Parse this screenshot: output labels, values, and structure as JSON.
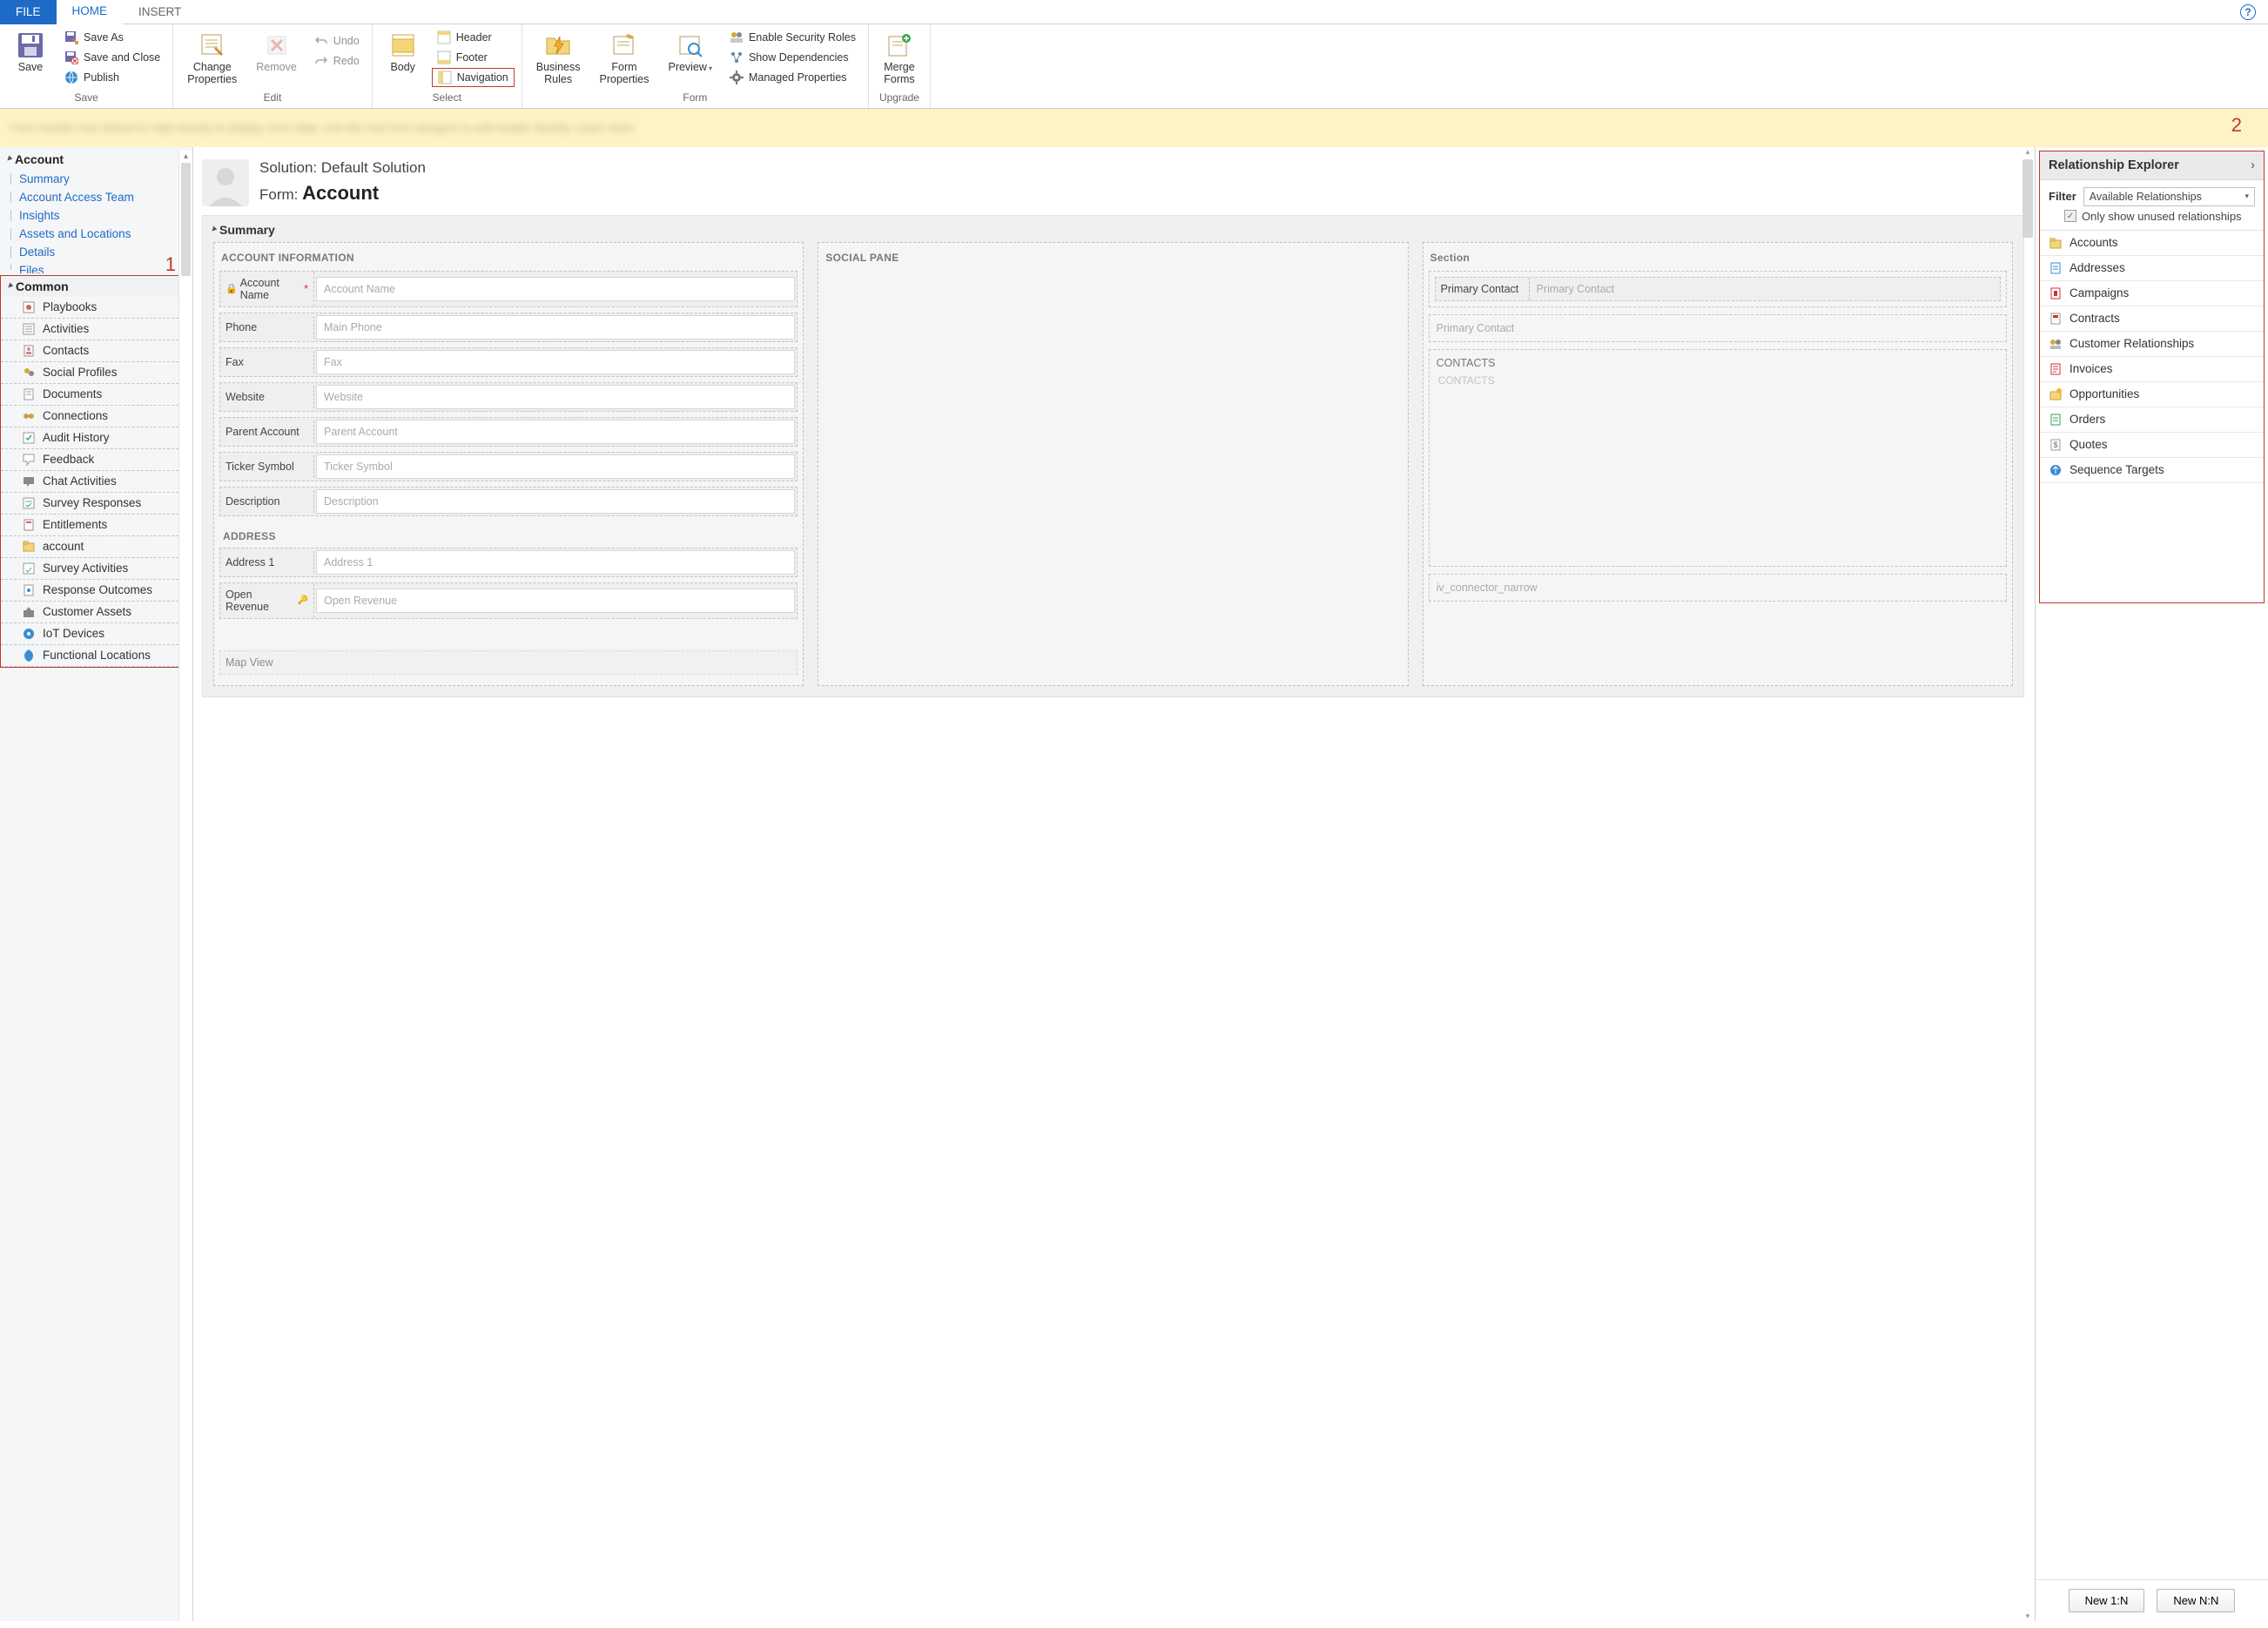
{
  "tabs": {
    "file": "FILE",
    "home": "HOME",
    "insert": "INSERT"
  },
  "ribbon": {
    "save_group": "Save",
    "edit_group": "Edit",
    "select_group": "Select",
    "form_group": "Form",
    "upgrade_group": "Upgrade",
    "save": "Save",
    "save_as": "Save As",
    "save_close": "Save and Close",
    "publish": "Publish",
    "change_props": "Change\nProperties",
    "remove": "Remove",
    "undo": "Undo",
    "redo": "Redo",
    "body": "Body",
    "header": "Header",
    "footer": "Footer",
    "navigation": "Navigation",
    "biz_rules": "Business\nRules",
    "form_props": "Form\nProperties",
    "preview": "Preview",
    "enable_sec": "Enable Security Roles",
    "show_dep": "Show Dependencies",
    "managed": "Managed Properties",
    "merge": "Merge\nForms"
  },
  "notice": {
    "callout": "2"
  },
  "left": {
    "account": "Account",
    "links": [
      "Summary",
      "Account Access Team",
      "Insights",
      "Assets and Locations",
      "Details",
      "Files"
    ],
    "callout": "1",
    "common": "Common",
    "items": [
      "Playbooks",
      "Activities",
      "Contacts",
      "Social Profiles",
      "Documents",
      "Connections",
      "Audit History",
      "Feedback",
      "Chat Activities",
      "Survey Responses",
      "Entitlements",
      "account",
      "Survey Activities",
      "Response Outcomes",
      "Customer Assets",
      "IoT Devices",
      "Functional Locations"
    ]
  },
  "canvas": {
    "solution_label": "Solution: ",
    "solution_name": "Default Solution",
    "form_label": "Form: ",
    "form_name": "Account",
    "summary": "Summary",
    "acct_info": "ACCOUNT INFORMATION",
    "social_pane": "SOCIAL PANE",
    "section": "Section",
    "fields": {
      "account_name": {
        "label": "Account Name",
        "ph": "Account Name",
        "req": "*"
      },
      "phone": {
        "label": "Phone",
        "ph": "Main Phone"
      },
      "fax": {
        "label": "Fax",
        "ph": "Fax"
      },
      "website": {
        "label": "Website",
        "ph": "Website"
      },
      "parent": {
        "label": "Parent Account",
        "ph": "Parent Account"
      },
      "ticker": {
        "label": "Ticker Symbol",
        "ph": "Ticker Symbol"
      },
      "desc": {
        "label": "Description",
        "ph": "Description"
      }
    },
    "address_hdr": "ADDRESS",
    "address1": {
      "label": "Address 1",
      "ph": "Address 1"
    },
    "open_rev": {
      "label": "Open Revenue",
      "ph": "Open Revenue"
    },
    "map_view": "Map View",
    "primary_contact_lbl": "Primary Contact",
    "primary_contact_ph": "Primary Contact",
    "primary_contact_ph2": "Primary Contact",
    "contacts_hdr": "CONTACTS",
    "contacts_body": "CONTACTS",
    "iv_conn": "iv_connector_narrow"
  },
  "right": {
    "title": "Relationship Explorer",
    "filter": "Filter",
    "filter_val": "Available Relationships",
    "only_unused": "Only show unused relationships",
    "items": [
      "Accounts",
      "Addresses",
      "Campaigns",
      "Contracts",
      "Customer Relationships",
      "Invoices",
      "Opportunities",
      "Orders",
      "Quotes",
      "Sequence Targets"
    ],
    "new_1n": "New 1:N",
    "new_nn": "New N:N"
  }
}
